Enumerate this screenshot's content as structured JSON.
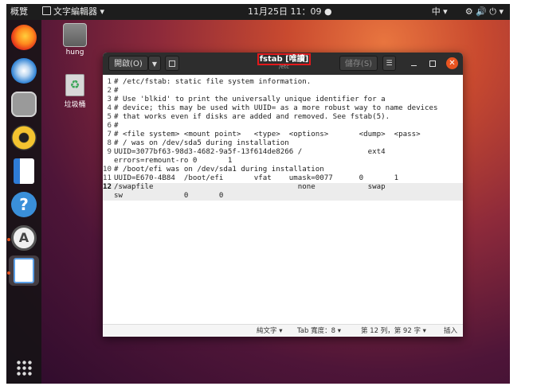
{
  "topbar": {
    "activities": "概覽",
    "app_menu": "文字編輯器 ▾",
    "clock": "11月25日 11：09 ●",
    "input_method": "中 ▾",
    "system_icons": "⚙ 🔊 ⏻ ▾"
  },
  "desktop": {
    "home_label": "hung",
    "trash_label": "垃圾桶"
  },
  "dock": {
    "items": [
      {
        "name": "firefox-icon",
        "color": "#f2711c"
      },
      {
        "name": "thunderbird-icon",
        "color": "#2a7fd4"
      },
      {
        "name": "files-icon",
        "color": "#b9b9b9"
      },
      {
        "name": "rhythmbox-icon",
        "color": "#e8c13b"
      },
      {
        "name": "writer-icon",
        "color": "#2e7bd6"
      },
      {
        "name": "help-icon",
        "color": "#3a8fd9"
      },
      {
        "name": "software-icon",
        "color": "#dddddd"
      },
      {
        "name": "text-editor-icon",
        "color": "#5a9ee6"
      }
    ]
  },
  "window": {
    "open_button": "開啟(O)",
    "title": "fstab [唯讀]",
    "subtitle": "/etc",
    "save_button": "儲存(S)",
    "lines": [
      {
        "num": "1",
        "text": "# /etc/fstab: static file system information."
      },
      {
        "num": "2",
        "text": "#"
      },
      {
        "num": "3",
        "text": "# Use 'blkid' to print the universally unique identifier for a"
      },
      {
        "num": "4",
        "text": "# device; this may be used with UUID= as a more robust way to name devices"
      },
      {
        "num": "5",
        "text": "# that works even if disks are added and removed. See fstab(5)."
      },
      {
        "num": "6",
        "text": "#"
      },
      {
        "num": "7",
        "text": "# <file system> <mount point>   <type>  <options>       <dump>  <pass>"
      },
      {
        "num": "8",
        "text": "# / was on /dev/sda5 during installation"
      },
      {
        "num": "9",
        "text": "UUID=3077bf63-98d3-4682-9a5f-13f614de8266 /               ext4"
      },
      {
        "num": "",
        "text": "errors=remount-ro 0       1"
      },
      {
        "num": "10",
        "text": "# /boot/efi was on /dev/sda1 during installation"
      },
      {
        "num": "11",
        "text": "UUID=E670-4B84  /boot/efi       vfat    umask=0077      0       1"
      },
      {
        "num": "12",
        "text": "/swapfile                                 none            swap"
      },
      {
        "num": "",
        "text": "sw              0       0"
      }
    ]
  },
  "statusbar": {
    "syntax": "純文字 ▾",
    "tab_width": "Tab 寬度：8 ▾",
    "position": "第 12 列，第 92 字 ▾",
    "mode": "插入"
  },
  "colors": {
    "accent": "#e95420",
    "highlight_box": "#e3181b",
    "header_bg": "#2d2d2d",
    "close_button": "#e95420"
  }
}
